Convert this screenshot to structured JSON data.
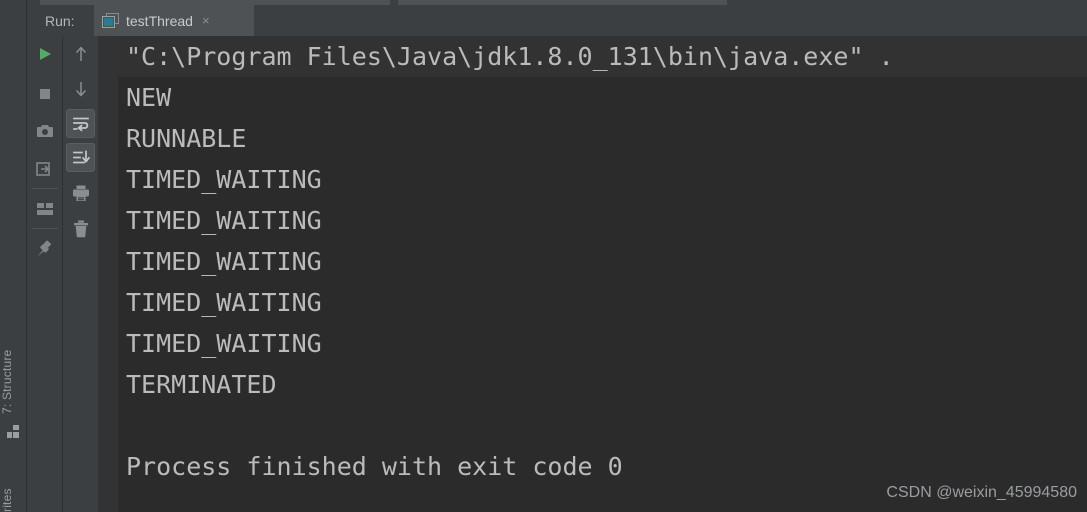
{
  "window": {
    "run_label": "Run:",
    "background_color": "#3c3f41",
    "console_background_color": "#2b2b2b",
    "console_text_color": "#bbbbbb",
    "accent_color": "#297b8e",
    "run_green": "#59a869"
  },
  "tab": {
    "label": "testThread",
    "close_glyph": "×",
    "icon": "run-configuration-icon"
  },
  "left_bar": {
    "structure_label": "7: Structure",
    "favorites_label": "rites"
  },
  "toolbar": {
    "column_a": [
      {
        "name": "rerun-button",
        "icon": "play-icon",
        "title": "Rerun",
        "active": false
      },
      {
        "name": "stop-button",
        "icon": "stop-icon",
        "title": "Stop",
        "active": false
      },
      {
        "name": "dump-threads-button",
        "icon": "camera-icon",
        "title": "Dump Threads",
        "active": false
      },
      {
        "name": "exit-button",
        "icon": "exit-icon",
        "title": "Exit",
        "active": false
      },
      {
        "name": "layout-button",
        "icon": "layout-icon",
        "title": "Layout",
        "active": false
      },
      {
        "name": "pin-tab-button",
        "icon": "pin-icon",
        "title": "Pin Tab",
        "active": false
      }
    ],
    "column_b": [
      {
        "name": "up-button",
        "icon": "arrow-up-icon",
        "title": "Up the Stack Trace",
        "active": false
      },
      {
        "name": "down-button",
        "icon": "arrow-down-icon",
        "title": "Down the Stack Trace",
        "active": false
      },
      {
        "name": "soft-wrap-button",
        "icon": "soft-wrap-icon",
        "title": "Use Soft Wraps",
        "active": true
      },
      {
        "name": "scroll-to-end-button",
        "icon": "scroll-to-end-icon",
        "title": "Scroll to the End",
        "active": true
      },
      {
        "name": "print-button",
        "icon": "printer-icon",
        "title": "Print",
        "active": false
      },
      {
        "name": "clear-all-button",
        "icon": "trash-icon",
        "title": "Clear All",
        "active": false
      }
    ]
  },
  "console": {
    "lines": [
      {
        "text": "\"C:\\Program Files\\Java\\jdk1.8.0_131\\bin\\java.exe\" .",
        "highlight": true
      },
      {
        "text": "NEW",
        "highlight": false
      },
      {
        "text": "RUNNABLE",
        "highlight": false
      },
      {
        "text": "TIMED_WAITING",
        "highlight": false
      },
      {
        "text": "TIMED_WAITING",
        "highlight": false
      },
      {
        "text": "TIMED_WAITING",
        "highlight": false
      },
      {
        "text": "TIMED_WAITING",
        "highlight": false
      },
      {
        "text": "TIMED_WAITING",
        "highlight": false
      },
      {
        "text": "TERMINATED",
        "highlight": false
      },
      {
        "text": "",
        "highlight": false
      },
      {
        "text": "Process finished with exit code 0",
        "highlight": false
      }
    ]
  },
  "watermark": {
    "text": "CSDN @weixin_45994580"
  }
}
